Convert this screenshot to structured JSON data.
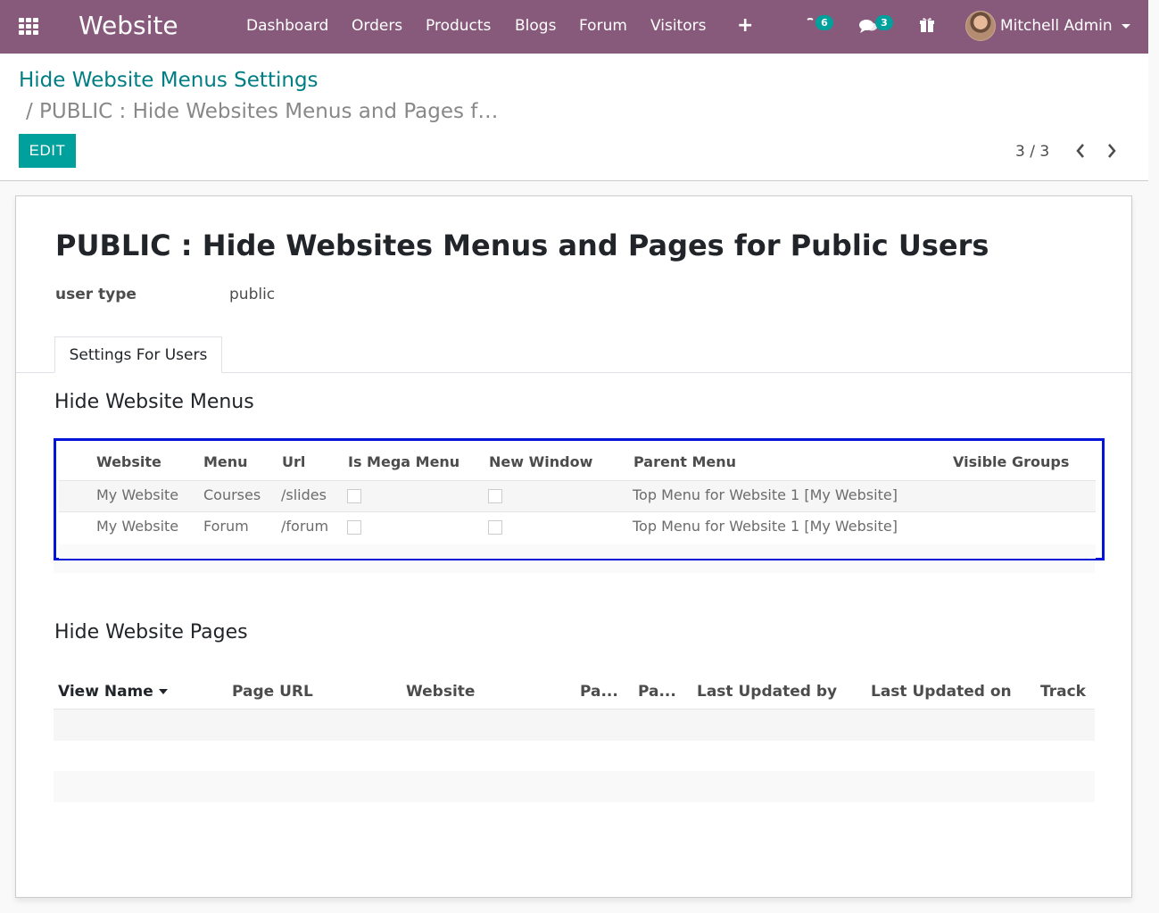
{
  "navbar": {
    "brand": "Website",
    "menus": [
      "Dashboard",
      "Orders",
      "Products",
      "Blogs",
      "Forum",
      "Visitors"
    ],
    "plus": "+",
    "activity_count": "6",
    "messages_count": "3",
    "user_name": "Mitchell Admin",
    "bg_color": "#875a7b"
  },
  "breadcrumb": {
    "parent": "Hide Website Menus Settings",
    "current": "/ PUBLIC : Hide Websites Menus and Pages f…"
  },
  "toolbar": {
    "edit_label": "EDIT",
    "pager": "3 / 3",
    "prev_icon": "‹",
    "next_icon": "›"
  },
  "form": {
    "title": "PUBLIC : Hide Websites Menus and Pages for Public Users",
    "user_type_label": "user type",
    "user_type_value": "public",
    "tab_label": "Settings For Users"
  },
  "menus_section": {
    "heading": "Hide Website Menus",
    "columns": [
      "Website",
      "Menu",
      "Url",
      "Is Mega Menu",
      "New Window",
      "Parent Menu",
      "Visible Groups"
    ],
    "rows": [
      {
        "website": "My Website",
        "menu": "Courses",
        "url": "/slides",
        "mega": false,
        "new_window": false,
        "parent": "Top Menu for Website 1 [My Website]",
        "groups": ""
      },
      {
        "website": "My Website",
        "menu": "Forum",
        "url": "/forum",
        "mega": false,
        "new_window": false,
        "parent": "Top Menu for Website 1 [My Website]",
        "groups": ""
      }
    ]
  },
  "pages_section": {
    "heading": "Hide Website Pages",
    "columns": [
      "View Name",
      "Page URL",
      "Website",
      "Pa...",
      "Pa...",
      "Last Updated by",
      "Last Updated on",
      "Track"
    ]
  },
  "colors": {
    "accent": "#00a09d",
    "link": "#017e84",
    "highlight_border": "#0015d8"
  }
}
